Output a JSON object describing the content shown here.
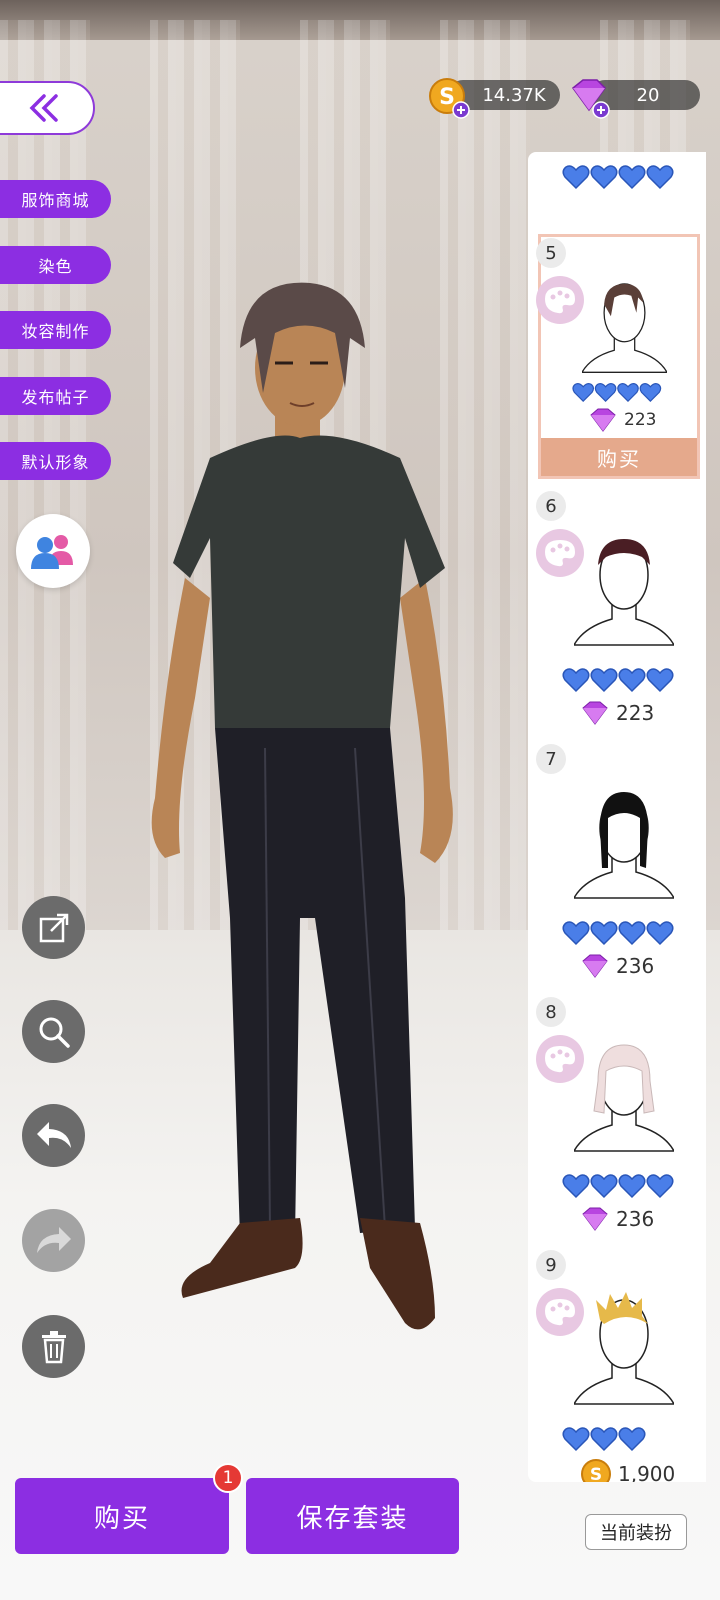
{
  "currency": {
    "coins": "14.37K",
    "gems": "20"
  },
  "menu": {
    "items": [
      "服饰商城",
      "染色",
      "妆容制作",
      "发布帖子",
      "默认形象"
    ]
  },
  "panel": {
    "items": [
      {
        "number": "5",
        "price": "223",
        "currency": "gem",
        "hearts": 4,
        "selected": true,
        "buy_label": "购买",
        "has_palette": true
      },
      {
        "number": "6",
        "price": "223",
        "currency": "gem",
        "hearts": 4,
        "selected": false,
        "has_palette": true
      },
      {
        "number": "7",
        "price": "236",
        "currency": "gem",
        "hearts": 4,
        "selected": false,
        "has_palette": false
      },
      {
        "number": "8",
        "price": "236",
        "currency": "gem",
        "hearts": 4,
        "selected": false,
        "has_palette": true
      },
      {
        "number": "9",
        "price": "1,900",
        "currency": "coin",
        "hearts": 3,
        "selected": false,
        "has_palette": true
      }
    ]
  },
  "bottom": {
    "buy_label": "购买",
    "buy_badge": "1",
    "save_label": "保存套装",
    "current_label": "当前装扮"
  },
  "colors": {
    "accent": "#8c2ee2",
    "heart": "#4a7ee8",
    "gem": "#b845e0",
    "coin": "#f0a820",
    "selected_bar": "#e5a98c"
  }
}
